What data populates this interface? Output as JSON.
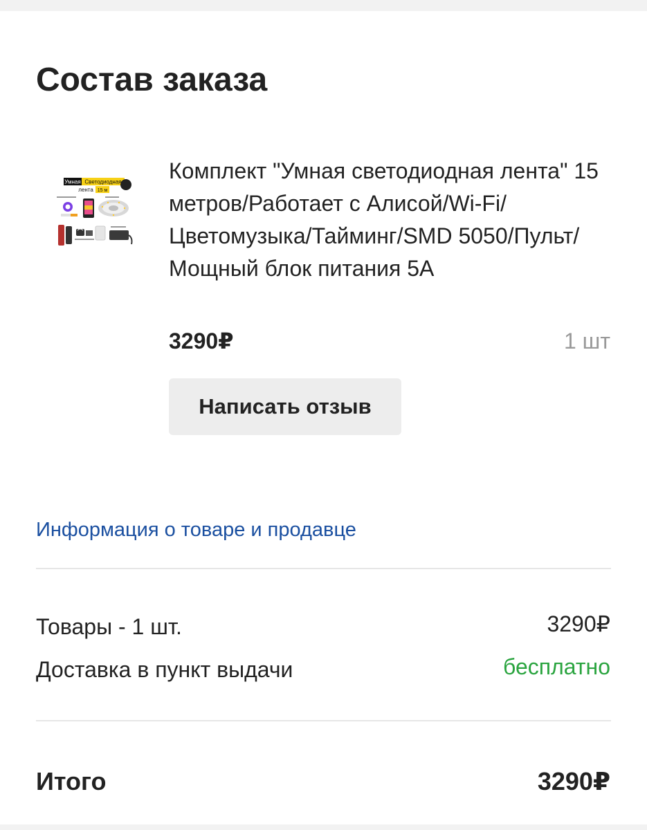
{
  "page": {
    "title": "Состав заказа"
  },
  "product": {
    "image_alt": "Умная Светодиодная лента 15 м",
    "image_text": {
      "word_smart": "Умная",
      "word_led": "Светодиодная",
      "word_strip": "лента",
      "length": "15 м"
    },
    "name": "Комплект \"Умная светодиодная лента\" 15 метров/Работает с Алисой/Wi-Fi/Цветомузыка/Тайминг/SMD 5050/Пульт/Мощный блок питания 5А",
    "price": "3290₽",
    "quantity": "1 шт",
    "review_button_label": "Написать отзыв"
  },
  "info_link": "Информация о товаре и продавце",
  "summary": {
    "goods_label": "Товары - 1 шт.",
    "goods_value": "3290₽",
    "delivery_label": "Доставка в пункт выдачи",
    "delivery_value": "бесплатно"
  },
  "total": {
    "label": "Итого",
    "value": "3290₽"
  },
  "colors": {
    "link": "#1a4fa0",
    "free_delivery": "#2aa43f",
    "button_bg": "#ededed",
    "image_accent": "#f7d117"
  }
}
